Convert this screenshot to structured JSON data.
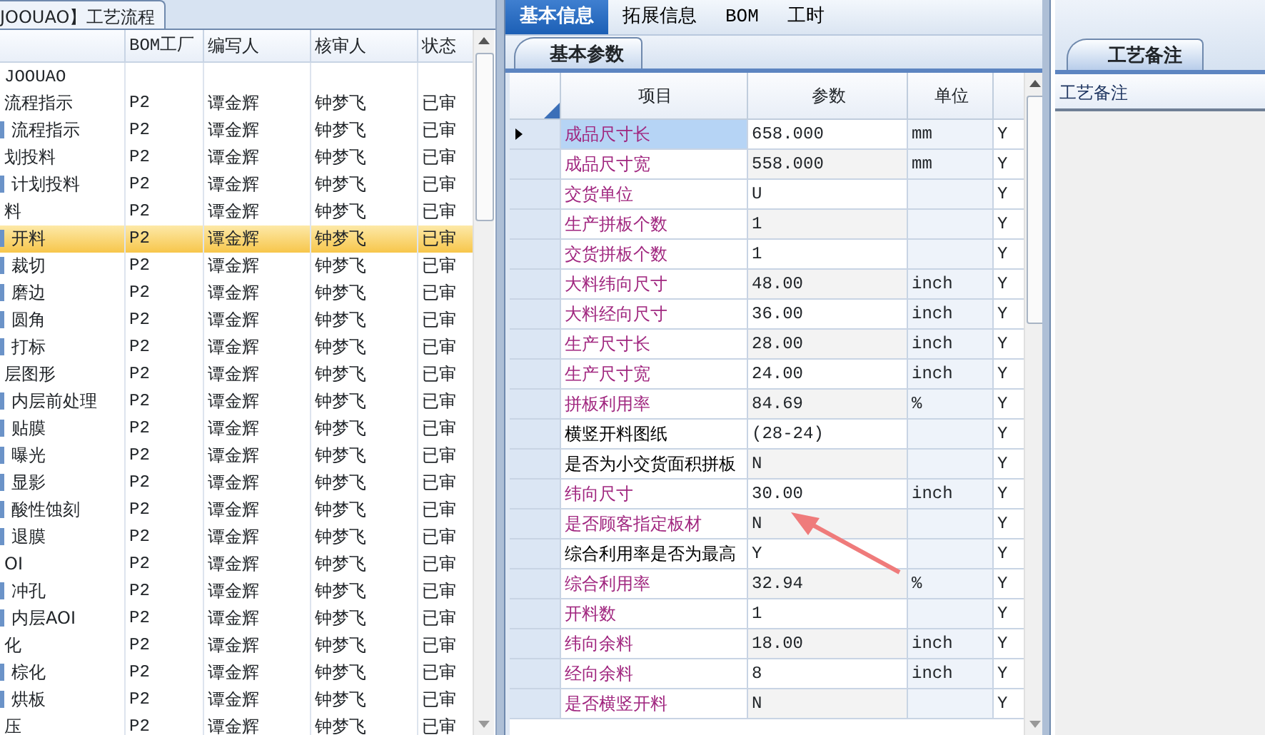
{
  "process_panel": {
    "tab": "JOOUAO】工艺流程",
    "columns": [
      "BOM工厂",
      "编写人",
      "核审人",
      "状态"
    ],
    "tree": [
      {
        "name": "JOOUAO",
        "selected": false,
        "children": [
          {
            "name": "流程指示",
            "factory": "P2",
            "writer": "谭金辉",
            "reviewer": "钟梦飞",
            "status": "已审",
            "selected": false,
            "children": [
              {
                "name": "流程指示",
                "factory": "P2",
                "writer": "谭金辉",
                "reviewer": "钟梦飞",
                "status": "已审",
                "selected": false
              }
            ]
          },
          {
            "name": "划投料",
            "factory": "P2",
            "writer": "谭金辉",
            "reviewer": "钟梦飞",
            "status": "已审",
            "selected": false,
            "children": [
              {
                "name": "计划投料",
                "factory": "P2",
                "writer": "谭金辉",
                "reviewer": "钟梦飞",
                "status": "已审",
                "selected": false
              }
            ]
          },
          {
            "name": "料",
            "factory": "P2",
            "writer": "谭金辉",
            "reviewer": "钟梦飞",
            "status": "已审",
            "selected": false,
            "children": [
              {
                "name": "开料",
                "factory": "P2",
                "writer": "谭金辉",
                "reviewer": "钟梦飞",
                "status": "已审",
                "selected": true
              },
              {
                "name": "裁切",
                "factory": "P2",
                "writer": "谭金辉",
                "reviewer": "钟梦飞",
                "status": "已审",
                "selected": false
              },
              {
                "name": "磨边",
                "factory": "P2",
                "writer": "谭金辉",
                "reviewer": "钟梦飞",
                "status": "已审",
                "selected": false
              },
              {
                "name": "圆角",
                "factory": "P2",
                "writer": "谭金辉",
                "reviewer": "钟梦飞",
                "status": "已审",
                "selected": false
              },
              {
                "name": "打标",
                "factory": "P2",
                "writer": "谭金辉",
                "reviewer": "钟梦飞",
                "status": "已审",
                "selected": false
              }
            ]
          },
          {
            "name": "层图形",
            "factory": "P2",
            "writer": "谭金辉",
            "reviewer": "钟梦飞",
            "status": "已审",
            "selected": false,
            "children": [
              {
                "name": "内层前处理",
                "factory": "P2",
                "writer": "谭金辉",
                "reviewer": "钟梦飞",
                "status": "已审",
                "selected": false
              },
              {
                "name": "贴膜",
                "factory": "P2",
                "writer": "谭金辉",
                "reviewer": "钟梦飞",
                "status": "已审",
                "selected": false
              },
              {
                "name": "曝光",
                "factory": "P2",
                "writer": "谭金辉",
                "reviewer": "钟梦飞",
                "status": "已审",
                "selected": false
              },
              {
                "name": "显影",
                "factory": "P2",
                "writer": "谭金辉",
                "reviewer": "钟梦飞",
                "status": "已审",
                "selected": false
              },
              {
                "name": "酸性蚀刻",
                "factory": "P2",
                "writer": "谭金辉",
                "reviewer": "钟梦飞",
                "status": "已审",
                "selected": false
              },
              {
                "name": "退膜",
                "factory": "P2",
                "writer": "谭金辉",
                "reviewer": "钟梦飞",
                "status": "已审",
                "selected": false
              }
            ]
          },
          {
            "name": "OI",
            "factory": "P2",
            "writer": "谭金辉",
            "reviewer": "钟梦飞",
            "status": "已审",
            "selected": false,
            "children": [
              {
                "name": "冲孔",
                "factory": "P2",
                "writer": "谭金辉",
                "reviewer": "钟梦飞",
                "status": "已审",
                "selected": false
              },
              {
                "name": "内层AOI",
                "factory": "P2",
                "writer": "谭金辉",
                "reviewer": "钟梦飞",
                "status": "已审",
                "selected": false
              }
            ]
          },
          {
            "name": "化",
            "factory": "P2",
            "writer": "谭金辉",
            "reviewer": "钟梦飞",
            "status": "已审",
            "selected": false,
            "children": [
              {
                "name": "棕化",
                "factory": "P2",
                "writer": "谭金辉",
                "reviewer": "钟梦飞",
                "status": "已审",
                "selected": false
              },
              {
                "name": "烘板",
                "factory": "P2",
                "writer": "谭金辉",
                "reviewer": "钟梦飞",
                "status": "已审",
                "selected": false
              }
            ]
          },
          {
            "name": "压",
            "factory": "P2",
            "writer": "谭金辉",
            "reviewer": "钟梦飞",
            "status": "已审",
            "selected": false
          }
        ]
      }
    ]
  },
  "tabs": [
    {
      "label": "基本信息",
      "selected": true
    },
    {
      "label": "拓展信息",
      "selected": false
    },
    {
      "label": "BOM",
      "selected": false
    },
    {
      "label": "工时",
      "selected": false
    }
  ],
  "subtab": "基本参数",
  "params": {
    "columns": [
      "项目",
      "参数",
      "单位"
    ],
    "rows": [
      {
        "item": "成品尺寸长",
        "value": "658.000",
        "unit": "mm",
        "flag": "Y",
        "color": "#a0267f",
        "selected": true
      },
      {
        "item": "成品尺寸宽",
        "value": "558.000",
        "unit": "mm",
        "flag": "Y",
        "color": "#a0267f",
        "selected": false
      },
      {
        "item": "交货单位",
        "value": "U",
        "flag": "Y",
        "color": "#a0267f",
        "selected": false
      },
      {
        "item": "生产拼板个数",
        "value": "1",
        "flag": "Y",
        "color": "#a0267f",
        "selected": false
      },
      {
        "item": "交货拼板个数",
        "value": "1",
        "flag": "Y",
        "color": "#a0267f",
        "selected": false
      },
      {
        "item": "大料纬向尺寸",
        "value": "48.00",
        "unit": "inch",
        "flag": "Y",
        "color": "#a0267f",
        "selected": false
      },
      {
        "item": "大料经向尺寸",
        "value": "36.00",
        "unit": "inch",
        "flag": "Y",
        "color": "#a0267f",
        "selected": false
      },
      {
        "item": "生产尺寸长",
        "value": "28.00",
        "unit": "inch",
        "flag": "Y",
        "color": "#a0267f",
        "selected": false
      },
      {
        "item": "生产尺寸宽",
        "value": "24.00",
        "unit": "inch",
        "flag": "Y",
        "color": "#a0267f",
        "selected": false
      },
      {
        "item": "拼板利用率",
        "value": "84.69",
        "unit": "%",
        "flag": "Y",
        "color": "#a0267f",
        "selected": false
      },
      {
        "item": "横竖开料图纸",
        "value": "(28-24)",
        "flag": "Y",
        "color": "#000000",
        "selected": false
      },
      {
        "item": "是否为小交货面积拼板",
        "value": "N",
        "flag": "Y",
        "color": "#000000",
        "selected": false
      },
      {
        "item": "纬向尺寸",
        "value": "30.00",
        "unit": "inch",
        "flag": "Y",
        "color": "#a0267f",
        "selected": false
      },
      {
        "item": "是否顾客指定板材",
        "value": "N",
        "flag": "Y",
        "color": "#a0267f",
        "selected": false
      },
      {
        "item": "综合利用率是否为最高",
        "value": "Y",
        "flag": "Y",
        "color": "#000000",
        "selected": false
      },
      {
        "item": "综合利用率",
        "value": "32.94",
        "unit": "%",
        "flag": "Y",
        "color": "#a0267f",
        "selected": false
      },
      {
        "item": "开料数",
        "value": "1",
        "flag": "Y",
        "color": "#a0267f",
        "selected": false
      },
      {
        "item": "纬向余料",
        "value": "18.00",
        "unit": "inch",
        "flag": "Y",
        "color": "#a0267f",
        "selected": false
      },
      {
        "item": "经向余料",
        "value": "8",
        "unit": "inch",
        "flag": "Y",
        "color": "#a0267f",
        "selected": false
      },
      {
        "item": "是否横竖开料",
        "value": "N",
        "flag": "Y",
        "color": "#a0267f",
        "selected": false
      }
    ]
  },
  "notes": {
    "tab": "工艺备注",
    "header": "工艺备注"
  }
}
